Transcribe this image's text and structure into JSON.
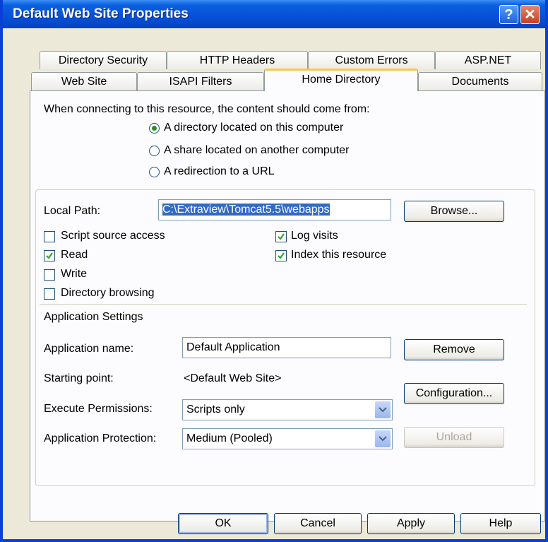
{
  "window": {
    "title": "Default Web Site Properties"
  },
  "tabs_row1": [
    {
      "label": "Directory Security"
    },
    {
      "label": "HTTP Headers"
    },
    {
      "label": "Custom Errors"
    },
    {
      "label": "ASP.NET"
    }
  ],
  "tabs_row2": [
    {
      "label": "Web Site"
    },
    {
      "label": "ISAPI Filters"
    },
    {
      "label": "Home Directory",
      "selected": true
    },
    {
      "label": "Documents"
    }
  ],
  "content_source": {
    "prompt": "When connecting to this resource, the content should come from:",
    "options": [
      {
        "label": "A directory located on this computer",
        "selected": true
      },
      {
        "label": "A share located on another computer",
        "selected": false
      },
      {
        "label": "A redirection to a URL",
        "selected": false
      }
    ]
  },
  "local_path": {
    "label": "Local Path:",
    "value": "C:\\Extraview\\Tomcat5.5\\webapps",
    "browse_label": "Browse..."
  },
  "permissions": [
    {
      "label": "Script source access",
      "checked": false
    },
    {
      "label": "Read",
      "checked": true
    },
    {
      "label": "Write",
      "checked": false
    },
    {
      "label": "Directory browsing",
      "checked": false
    },
    {
      "label": "Log visits",
      "checked": true
    },
    {
      "label": "Index this resource",
      "checked": true
    }
  ],
  "app_settings": {
    "heading": "Application Settings",
    "name_label": "Application name:",
    "name_value": "Default Application",
    "remove_label": "Remove",
    "starting_point_label": "Starting point:",
    "starting_point_value": "<Default Web Site>",
    "configuration_label": "Configuration...",
    "exec_perm_label": "Execute Permissions:",
    "exec_perm_value": "Scripts only",
    "protection_label": "Application Protection:",
    "protection_value": "Medium (Pooled)",
    "unload_label": "Unload"
  },
  "footer": {
    "ok": "OK",
    "cancel": "Cancel",
    "apply": "Apply",
    "help": "Help"
  }
}
